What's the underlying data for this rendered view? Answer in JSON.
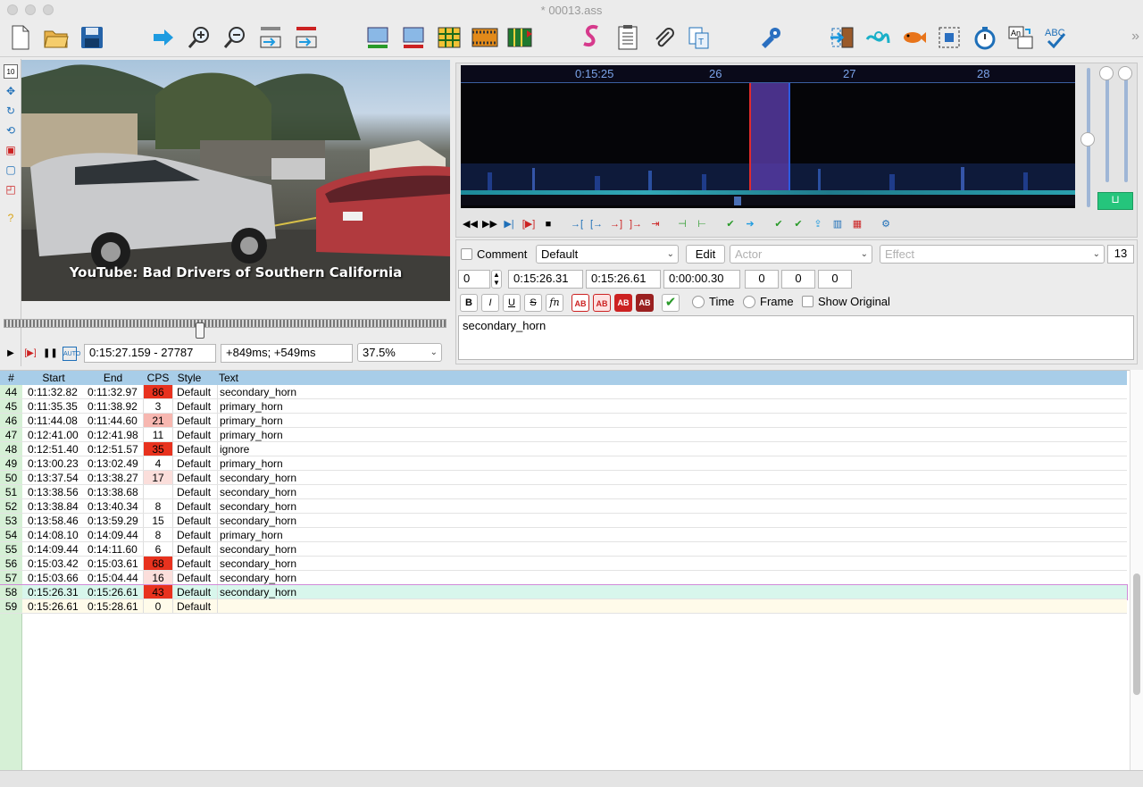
{
  "window": {
    "title": "* 00013.ass"
  },
  "toolbar": {
    "icons": [
      "new-file",
      "open-folder",
      "save",
      "jump-arrow",
      "zoom-in",
      "zoom-out",
      "jump-to-start",
      "jump-to-end",
      "shift-up",
      "shift-down",
      "spreadsheet",
      "film-strip",
      "film-marked",
      "script-s",
      "notes",
      "paperclip",
      "copy-text",
      "gear-puzzle",
      "exit-arrow",
      "swirl",
      "fish",
      "select-box",
      "stopwatch",
      "translation",
      "spell-check"
    ],
    "more": "»"
  },
  "video": {
    "caption": "YouTube: Bad Drivers of Southern California",
    "position": "0:15:27.159 - 27787",
    "offset": "+849ms; +549ms",
    "zoom": "37.5%",
    "seek_fraction": 0.44
  },
  "audio": {
    "ticks": [
      "0:15:25",
      "26",
      "27",
      "28"
    ],
    "selection_start_sec": 26.31,
    "selection_end_sec": 26.61,
    "lock_symbol": "⊔"
  },
  "editor": {
    "comment_label": "Comment",
    "style": "Default",
    "edit_label": "Edit",
    "actor_placeholder": "Actor",
    "effect_placeholder": "Effect",
    "char_count": "13",
    "layer": "0",
    "start": "0:15:26.31",
    "end": "0:15:26.61",
    "duration": "0:00:00.30",
    "margin_l": "0",
    "margin_r": "0",
    "margin_v": "0",
    "bold": "B",
    "italic": "I",
    "underline": "U",
    "strike": "S",
    "fn": "fn",
    "ab": "AB",
    "time_label": "Time",
    "frame_label": "Frame",
    "show_original_label": "Show Original",
    "text": "secondary_horn"
  },
  "grid": {
    "headers": {
      "num": "#",
      "start": "Start",
      "end": "End",
      "cps": "CPS",
      "style": "Style",
      "text": "Text"
    },
    "rows": [
      {
        "num": "44",
        "start": "0:11:32.82",
        "end": "0:11:32.97",
        "cps": "86",
        "cps_color": "#e8321e",
        "style": "Default",
        "text": "secondary_horn"
      },
      {
        "num": "45",
        "start": "0:11:35.35",
        "end": "0:11:38.92",
        "cps": "3",
        "cps_color": "",
        "style": "Default",
        "text": "primary_horn"
      },
      {
        "num": "46",
        "start": "0:11:44.08",
        "end": "0:11:44.60",
        "cps": "21",
        "cps_color": "#f7b7b0",
        "style": "Default",
        "text": "primary_horn"
      },
      {
        "num": "47",
        "start": "0:12:41.00",
        "end": "0:12:41.98",
        "cps": "11",
        "cps_color": "",
        "style": "Default",
        "text": "primary_horn"
      },
      {
        "num": "48",
        "start": "0:12:51.40",
        "end": "0:12:51.57",
        "cps": "35",
        "cps_color": "#e8321e",
        "style": "Default",
        "text": "ignore"
      },
      {
        "num": "49",
        "start": "0:13:00.23",
        "end": "0:13:02.49",
        "cps": "4",
        "cps_color": "",
        "style": "Default",
        "text": "primary_horn"
      },
      {
        "num": "50",
        "start": "0:13:37.54",
        "end": "0:13:38.27",
        "cps": "17",
        "cps_color": "#fbdedb",
        "style": "Default",
        "text": "secondary_horn"
      },
      {
        "num": "51",
        "start": "0:13:38.56",
        "end": "0:13:38.68",
        "cps": "",
        "cps_color": "",
        "style": "Default",
        "text": "secondary_horn"
      },
      {
        "num": "52",
        "start": "0:13:38.84",
        "end": "0:13:40.34",
        "cps": "8",
        "cps_color": "",
        "style": "Default",
        "text": "secondary_horn"
      },
      {
        "num": "53",
        "start": "0:13:58.46",
        "end": "0:13:59.29",
        "cps": "15",
        "cps_color": "",
        "style": "Default",
        "text": "secondary_horn"
      },
      {
        "num": "54",
        "start": "0:14:08.10",
        "end": "0:14:09.44",
        "cps": "8",
        "cps_color": "",
        "style": "Default",
        "text": "primary_horn"
      },
      {
        "num": "55",
        "start": "0:14:09.44",
        "end": "0:14:11.60",
        "cps": "6",
        "cps_color": "",
        "style": "Default",
        "text": "secondary_horn"
      },
      {
        "num": "56",
        "start": "0:15:03.42",
        "end": "0:15:03.61",
        "cps": "68",
        "cps_color": "#e8321e",
        "style": "Default",
        "text": "secondary_horn"
      },
      {
        "num": "57",
        "start": "0:15:03.66",
        "end": "0:15:04.44",
        "cps": "16",
        "cps_color": "#fbdedb",
        "style": "Default",
        "text": "secondary_horn"
      },
      {
        "num": "58",
        "start": "0:15:26.31",
        "end": "0:15:26.61",
        "cps": "43",
        "cps_color": "#e8321e",
        "style": "Default",
        "text": "secondary_horn",
        "selected": true
      },
      {
        "num": "59",
        "start": "0:15:26.61",
        "end": "0:15:28.61",
        "cps": "0",
        "cps_color": "",
        "style": "Default",
        "text": "",
        "active": true
      }
    ]
  }
}
